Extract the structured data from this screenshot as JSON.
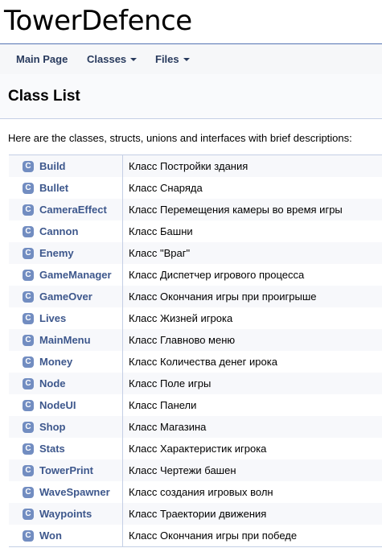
{
  "project": {
    "name": "TowerDefence"
  },
  "nav": {
    "main_page": "Main Page",
    "classes": "Classes",
    "files": "Files"
  },
  "header": {
    "title": "Class List"
  },
  "intro": "Here are the classes, structs, unions and interfaces with brief descriptions:",
  "class_icon_letter": "C",
  "classes": [
    {
      "name": "Build",
      "description": "Класс Постройки здания"
    },
    {
      "name": "Bullet",
      "description": "Класс Снаряда"
    },
    {
      "name": "CameraEffect",
      "description": "Класс Перемещения камеры во время игры"
    },
    {
      "name": "Cannon",
      "description": "Класс Башни"
    },
    {
      "name": "Enemy",
      "description": "Класс \"Враг\""
    },
    {
      "name": "GameManager",
      "description": "Класс Диспетчер игрового процесса"
    },
    {
      "name": "GameOver",
      "description": "Класс Окончания игры при проигрыше"
    },
    {
      "name": "Lives",
      "description": "Класс Жизней игрока"
    },
    {
      "name": "MainMenu",
      "description": "Класс Главново меню"
    },
    {
      "name": "Money",
      "description": "Класс Количества денег ирока"
    },
    {
      "name": "Node",
      "description": "Класс Поле игры"
    },
    {
      "name": "NodeUI",
      "description": "Класс Панели"
    },
    {
      "name": "Shop",
      "description": "Класс Магазина"
    },
    {
      "name": "Stats",
      "description": "Класс Характеристик игрока"
    },
    {
      "name": "TowerPrint",
      "description": "Класс Чертежи башен"
    },
    {
      "name": "WaveSpawner",
      "description": "Класс создания игровых волн"
    },
    {
      "name": "Waypoints",
      "description": "Класс Траектории движения"
    },
    {
      "name": "Won",
      "description": "Класс Окончания игры при победе"
    }
  ]
}
